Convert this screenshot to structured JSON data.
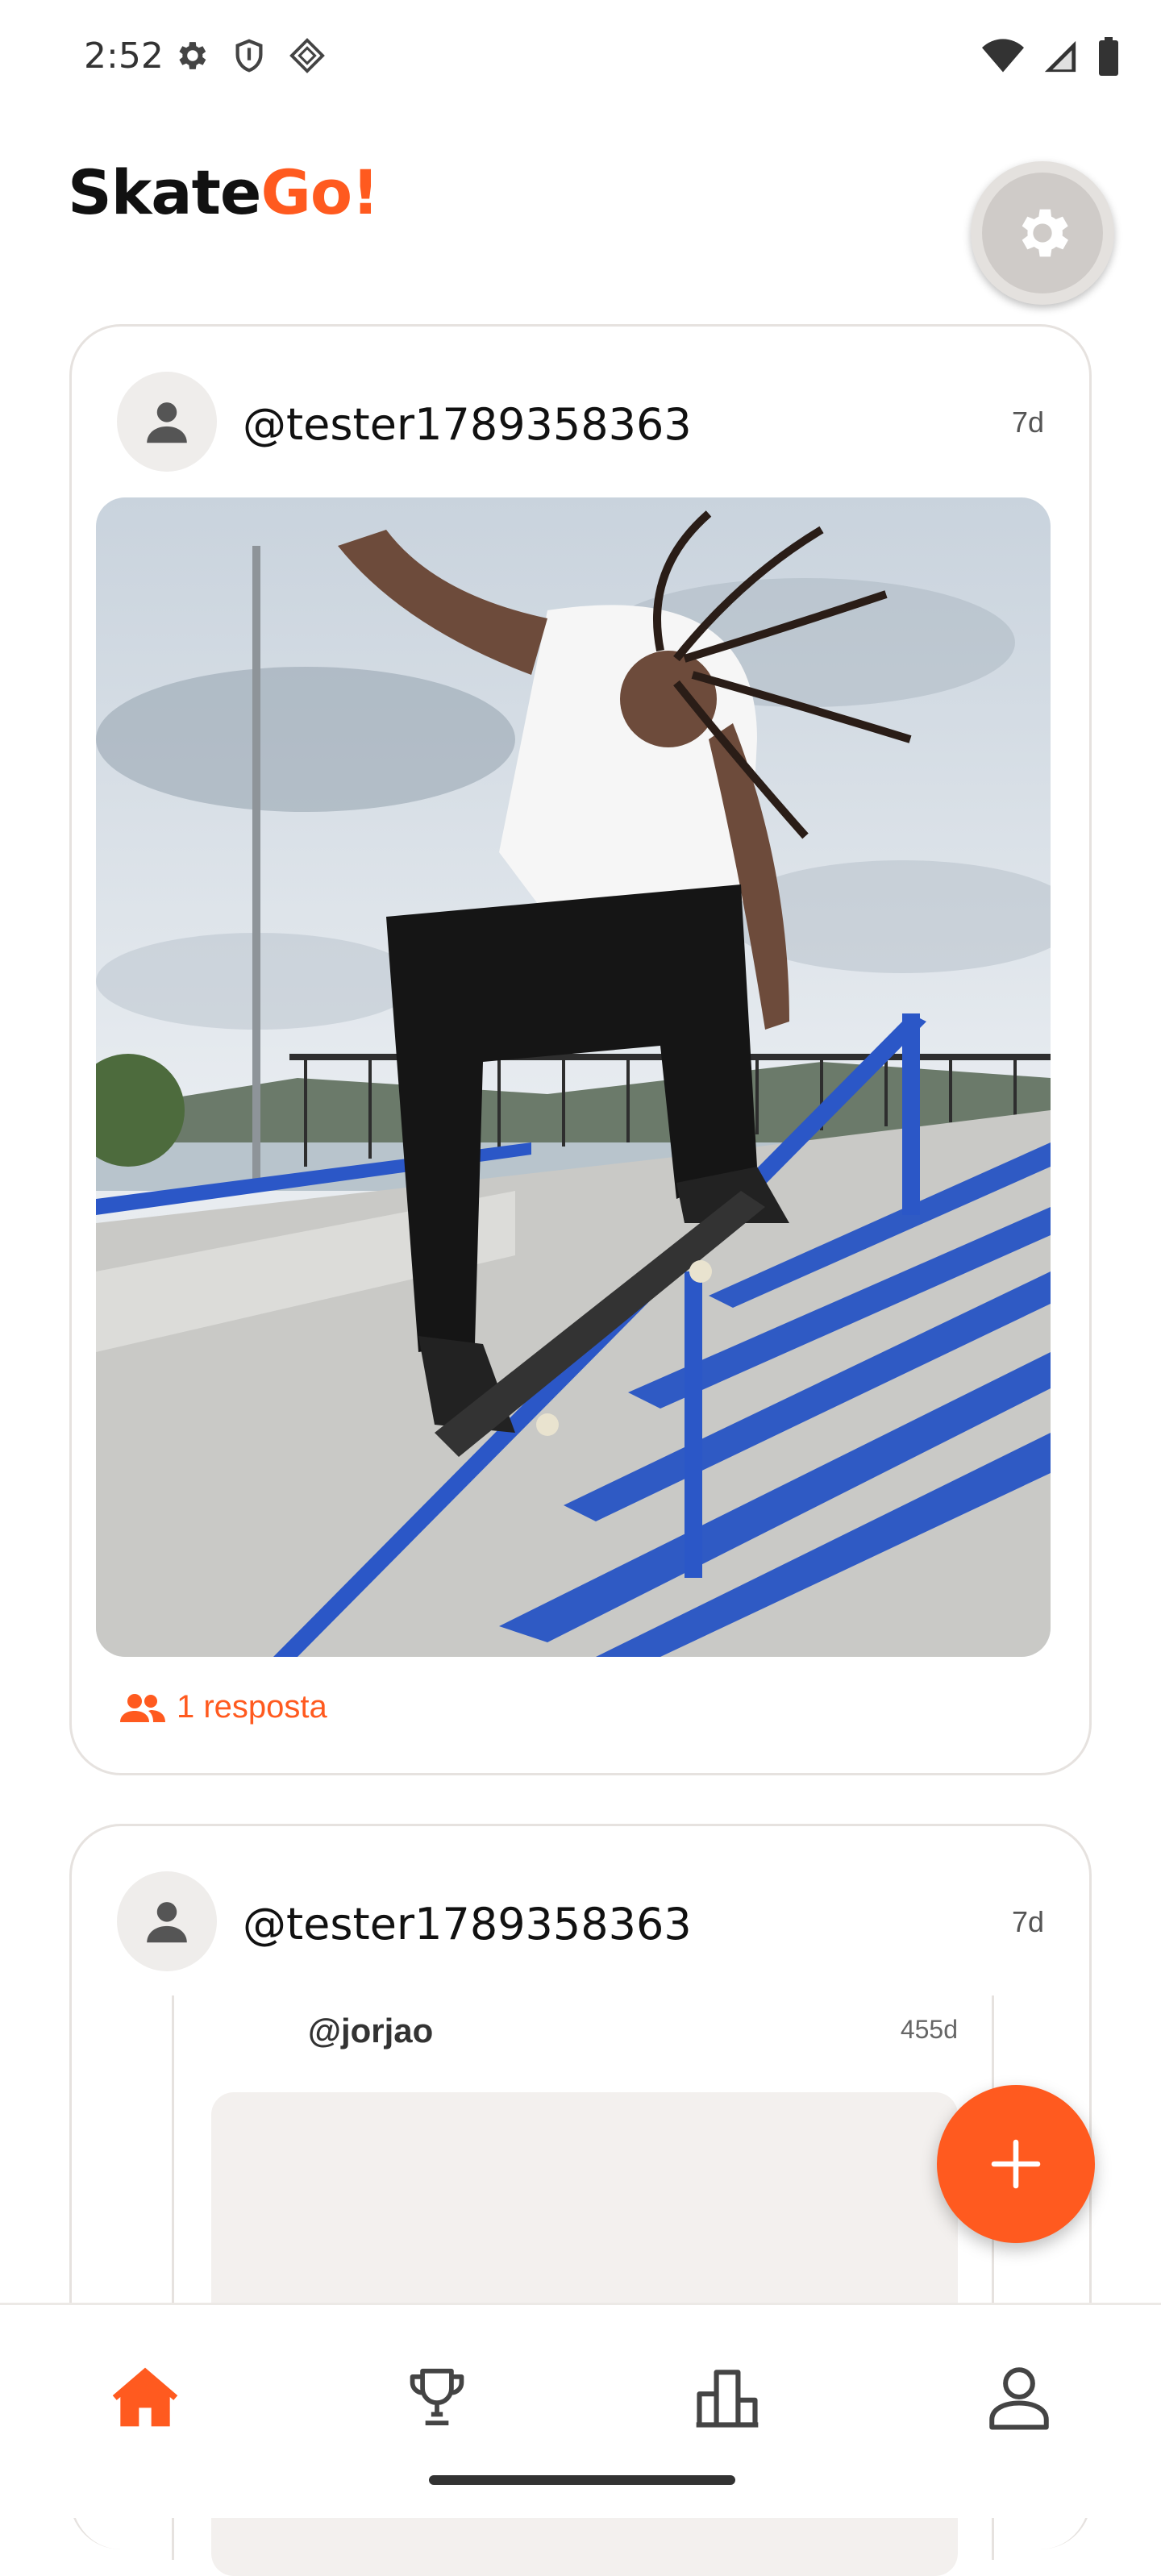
{
  "status_bar": {
    "time": "2:52",
    "left_icons": [
      "gear-icon",
      "shield-icon",
      "diamond-icon"
    ],
    "right_icons": [
      "wifi-icon",
      "signal-icon",
      "battery-icon"
    ]
  },
  "header": {
    "brand_part1": "Skate",
    "brand_part2": "Go!",
    "brand_accent_color": "#ff5a1f",
    "settings_icon": "gear-icon"
  },
  "feed": {
    "posts": [
      {
        "username": "@tester1789358363",
        "time": "7d",
        "media": "photo of skater grinding handrail",
        "reply_label": "1 resposta"
      },
      {
        "username": "@tester1789358363",
        "time": "7d",
        "nested": {
          "username": "@jorjao",
          "time": "455d"
        }
      }
    ]
  },
  "fab": {
    "icon": "plus-icon"
  },
  "bottom_nav": [
    {
      "icon": "home-icon",
      "active": true
    },
    {
      "icon": "trophy-icon",
      "active": false
    },
    {
      "icon": "leaderboard-icon",
      "active": false
    },
    {
      "icon": "profile-icon",
      "active": false
    }
  ],
  "colors": {
    "accent": "#ff5a1f",
    "nav_inactive": "#444444",
    "card_border": "#e6e2df"
  }
}
